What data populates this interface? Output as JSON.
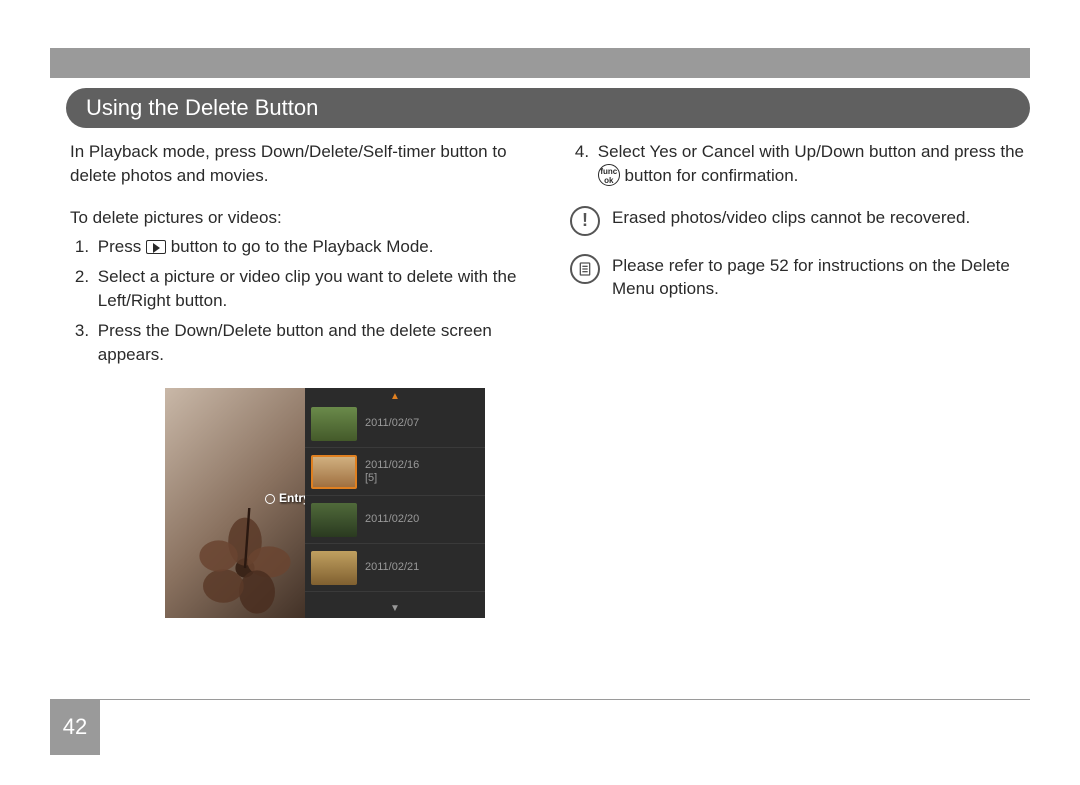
{
  "pageNumber": "42",
  "title": "Using the Delete Button",
  "left": {
    "intro": "In Playback mode, press Down/Delete/Self-timer button to delete photos and movies.",
    "subhead": "To delete pictures or videos:",
    "steps": {
      "s1a": "Press ",
      "s1b": " button to go to the Playback Mode.",
      "s2": "Select a picture or video clip you want to delete with the Left/Right button.",
      "s3": "Press the Down/Delete button and the delete screen appears."
    }
  },
  "right": {
    "step4a": "Select Yes or Cancel with Up/Down button and press the ",
    "step4b": " button for confirmation.",
    "funcTop": "func",
    "funcBot": "ok",
    "warn": "Erased photos/video clips cannot be recovered.",
    "note": "Please refer to page 52 for instructions on the Delete Menu options."
  },
  "screenshot": {
    "entryLabel": "Entry",
    "rows": [
      {
        "date": "2011/02/07"
      },
      {
        "date": "2011/02/16",
        "count": "[5]"
      },
      {
        "date": "2011/02/20"
      },
      {
        "date": "2011/02/21"
      }
    ]
  }
}
